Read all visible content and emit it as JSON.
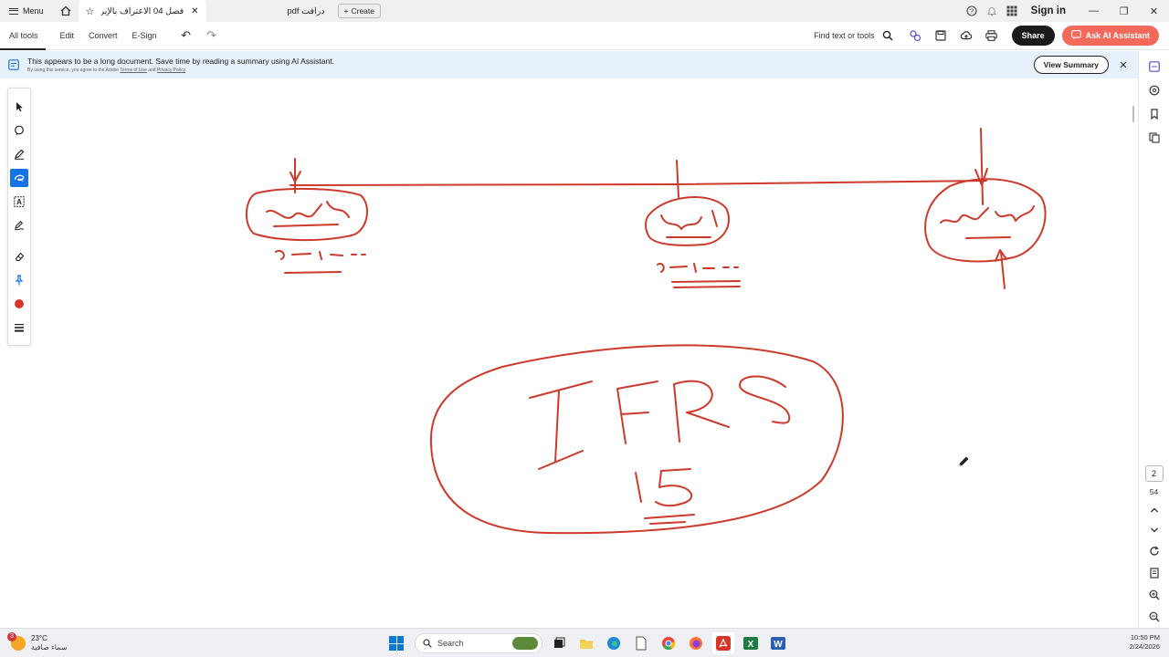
{
  "titlebar": {
    "menu_label": "Menu",
    "active_tab_title": "فصل 04 الاعتراف بالإيراد ..",
    "second_tab_title": "درافت pdf",
    "create_label": "Create",
    "sign_in_label": "Sign in"
  },
  "toolbar": {
    "items": [
      "All tools",
      "Edit",
      "Convert",
      "E-Sign"
    ],
    "find_label": "Find text or tools",
    "share_label": "Share",
    "ai_label": "Ask AI Assistant"
  },
  "banner": {
    "message": "This appears to be a long document. Save time by reading a summary using AI Assistant.",
    "fine_print_prefix": "By using this service, you agree to the Adobe",
    "terms_link": "Terms of Use",
    "and_text": "and",
    "privacy_link": "Privacy Policy",
    "view_summary_label": "View Summary"
  },
  "colors": {
    "ink": "#cd3a2c",
    "accent_blue": "#1473e6",
    "ai_button": "#f36a5d"
  },
  "right_rail": {
    "current_page": "2",
    "total_pages": "54"
  },
  "taskbar": {
    "weather_badge": "3",
    "temperature": "23°C",
    "condition": "سماء صافية",
    "search_placeholder": "Search",
    "time": "10:50 PM",
    "date": "2/24/2026"
  }
}
